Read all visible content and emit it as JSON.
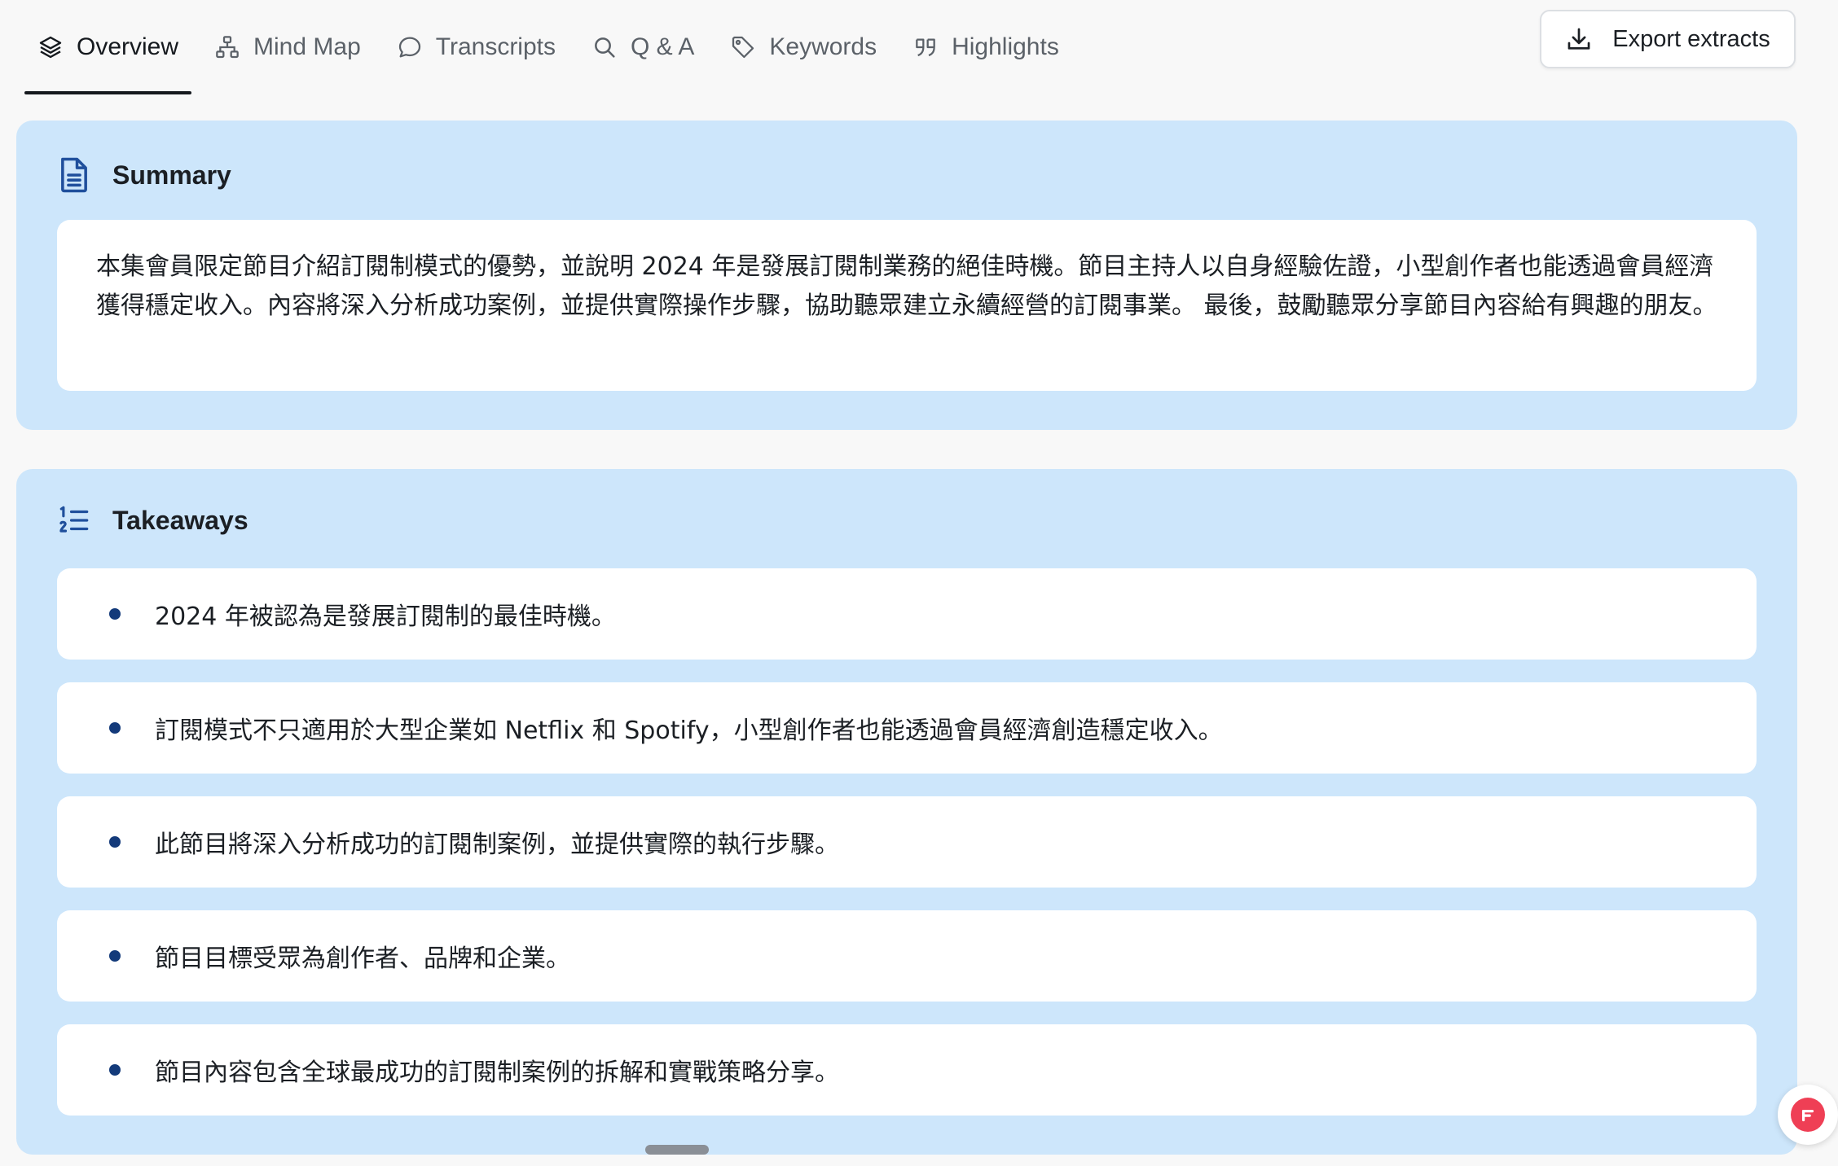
{
  "tabs": [
    {
      "label": "Overview",
      "icon": "layers-icon",
      "active": true
    },
    {
      "label": "Mind Map",
      "icon": "mind-map-icon",
      "active": false
    },
    {
      "label": "Transcripts",
      "icon": "chat-bubble-icon",
      "active": false
    },
    {
      "label": "Q & A",
      "icon": "search-icon",
      "active": false
    },
    {
      "label": "Keywords",
      "icon": "tag-icon",
      "active": false
    },
    {
      "label": "Highlights",
      "icon": "quote-icon",
      "active": false
    }
  ],
  "export": {
    "label": "Export extracts",
    "icon": "download-icon"
  },
  "summary": {
    "title": "Summary",
    "icon": "document-icon",
    "text": "本集會員限定節目介紹訂閱制模式的優勢，並說明 2024 年是發展訂閱制業務的絕佳時機。節目主持人以自身經驗佐證，小型創作者也能透過會員經濟獲得穩定收入。內容將深入分析成功案例，並提供實際操作步驟，協助聽眾建立永續經營的訂閱事業。 最後，鼓勵聽眾分享節目內容給有興趣的朋友。"
  },
  "takeaways": {
    "title": "Takeaways",
    "icon": "numbered-list-icon",
    "items": [
      "2024 年被認為是發展訂閱制的最佳時機。",
      "訂閱模式不只適用於大型企業如 Netflix 和 Spotify，小型創作者也能透過會員經濟創造穩定收入。",
      "此節目將深入分析成功的訂閱制案例，並提供實際的執行步驟。",
      "節目目標受眾為創作者、品牌和企業。",
      "節目內容包含全球最成功的訂閱制案例的拆解和實戰策略分享。"
    ]
  },
  "colors": {
    "panel_bg": "#cde6fb",
    "card_bg": "#ffffff",
    "bullet": "#133a7a",
    "icon_blue": "#1f4f9c",
    "fab_red": "#ef3f55"
  }
}
